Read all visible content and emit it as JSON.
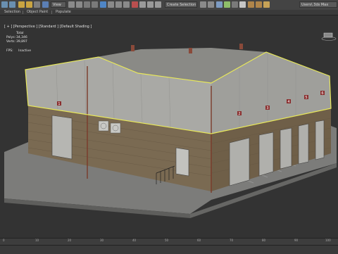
{
  "toolbar": {
    "view_dropdown": "View",
    "selection_set_dropdown": "Create Selection Se",
    "workspace_dropdown": "Users\\ 3ds Max",
    "icons": [
      "undo-icon",
      "redo-icon",
      "link-icon",
      "unlink-icon",
      "bind-icon",
      "select-filter-icon",
      "select-object-icon",
      "select-by-name-icon",
      "rect-region-icon",
      "window-crossing-icon",
      "move-icon",
      "rotate-icon",
      "scale-icon",
      "pivot-icon",
      "snap-icon",
      "angle-snap-icon",
      "percent-snap-icon",
      "spinner-snap-icon",
      "mirror-icon",
      "align-icon",
      "layers-icon",
      "curve-editor-icon",
      "schematic-icon",
      "material-editor-icon",
      "render-setup-icon",
      "render-frame-icon",
      "render-icon"
    ]
  },
  "ribbon": {
    "tabs": [
      "Selection",
      "Object Paint",
      "Populate"
    ]
  },
  "viewport": {
    "label": "[ + ] [Perspective ] [Standard ] [Default Shading ]",
    "stats": {
      "header": "Total",
      "polys_label": "Polys:",
      "polys_value": "34,346",
      "verts_label": "Verts:",
      "verts_value": "39,897",
      "fps_label": "FPS:",
      "fps_value": "Inactive"
    },
    "door_numbers": [
      "1",
      "2",
      "3",
      "4",
      "5",
      "6"
    ]
  },
  "timeline": {
    "ticks": [
      "0",
      "10",
      "20",
      "30",
      "40",
      "50",
      "60",
      "70",
      "80",
      "90",
      "100"
    ]
  },
  "colors": {
    "selection_outline": "#e8e85a",
    "brick": "#7a6a52",
    "metal_wall": "#a8a8a4",
    "ground": "#7a7a78",
    "background": "#333333"
  }
}
